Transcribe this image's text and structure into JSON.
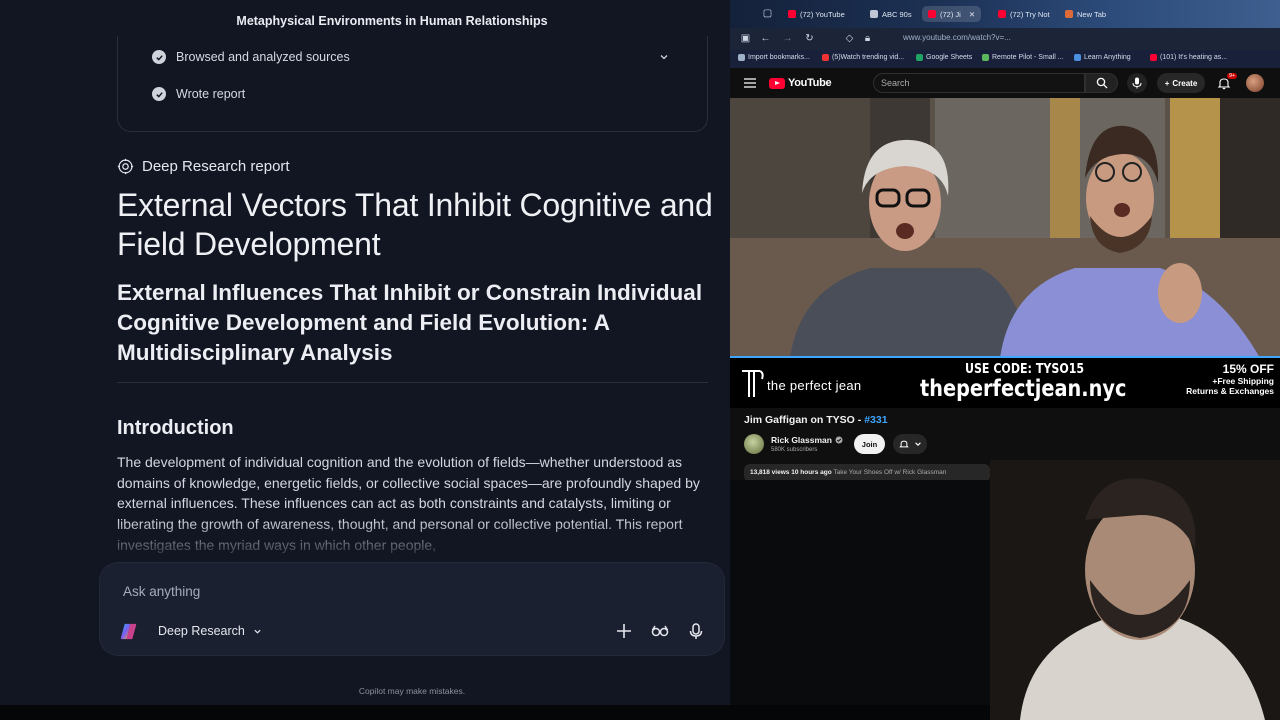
{
  "copilot": {
    "chat_title": "Metaphysical Environments in Human Relationships",
    "steps": [
      "Browsed and analyzed sources",
      "Wrote report"
    ],
    "report_label": "Deep Research report",
    "report_title": "External Vectors That Inhibit Cognitive and Field Development",
    "report_subtitle": "External Influences That Inhibit or Constrain Individual Cognitive Development and Field Evolution: A Multidisciplinary Analysis",
    "section_heading": "Introduction",
    "intro_text": "The development of individual cognition and the evolution of fields—whether understood as domains of knowledge, energetic fields, or collective social spaces—are profoundly shaped by external influences. These influences can act as both constraints and catalysts, limiting or liberating the growth of awareness, thought, and personal or collective potential. This report investigates the myriad ways in which other people,",
    "composer_placeholder": "Ask anything",
    "mode_label": "Deep Research",
    "footer_note": "Copilot may make mistakes."
  },
  "browser": {
    "tabs": [
      {
        "label": "(72) YouTube",
        "color": "#ff0033"
      },
      {
        "label": "ABC 90s",
        "color": "#c0c6d4"
      },
      {
        "label": "(72) Ji",
        "color": "#ff0033",
        "active": true
      },
      {
        "label": "(72) Try Not",
        "color": "#ff0033"
      },
      {
        "label": "New Tab",
        "color": "#e06b3a"
      }
    ],
    "url": "www.youtube.com/watch?v=...",
    "bookmarks": [
      {
        "label": "Import bookmarks...",
        "color": "#9fb0c9"
      },
      {
        "label": "(5)Watch trending vid...",
        "color": "#e33"
      },
      {
        "label": "Google Sheets",
        "color": "#1fa463"
      },
      {
        "label": "Remote Pilot - Small ...",
        "color": "#5cb85c"
      },
      {
        "label": "Learn Anything",
        "color": "#4a8fe0"
      },
      {
        "label": "(101) It's heating as...",
        "color": "#ff0033"
      }
    ]
  },
  "youtube": {
    "search_placeholder": "Search",
    "create_label": "Create",
    "notif_badge": "9+",
    "ad": {
      "brand": "the perfect jean",
      "code_label": "USE CODE: TYSO15",
      "url": "theperfectjean.nyc",
      "offer_line1": "15% OFF",
      "offer_line2": "+Free Shipping",
      "offer_line3": "Returns & Exchanges"
    },
    "video_title": "Jim Gaffigan on TYSO - ",
    "video_tag": "#331",
    "channel_name": "Rick Glassman",
    "channel_subs": "580K subscribers",
    "join_label": "Join",
    "views": "13,818 views",
    "age": "10 hours ago",
    "desc_channel": "Take Your Shoes Off w/ Rick Glassman"
  }
}
